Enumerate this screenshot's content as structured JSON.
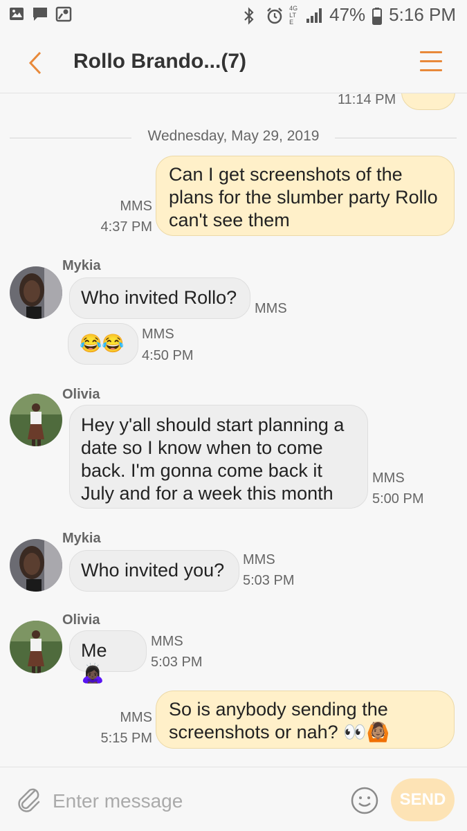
{
  "status_bar": {
    "battery": "47%",
    "time": "5:16 PM",
    "network": "4G LTE"
  },
  "header": {
    "title": "Rollo Brando...(7)"
  },
  "conversation": {
    "prev_time": "11:14 PM",
    "date_separator": "Wednesday, May 29, 2019",
    "messages": [
      {
        "dir": "out",
        "text": "Can I get screenshots of the plans for the slumber party Rollo can't see them",
        "type": "MMS",
        "time": "4:37 PM"
      },
      {
        "dir": "in",
        "sender": "Mykia",
        "text": "Who invited Rollo?",
        "type": "MMS"
      },
      {
        "dir": "in",
        "text": "😂😂",
        "type": "MMS",
        "time": "4:50 PM"
      },
      {
        "dir": "in",
        "sender": "Olivia",
        "text": "Hey y'all should start planning a date so I know when to come back. I'm gonna come back it July and for a week this month",
        "type": "MMS",
        "time": "5:00 PM"
      },
      {
        "dir": "in",
        "sender": "Mykia",
        "text": "Who invited you?",
        "type": "MMS",
        "time": "5:03 PM"
      },
      {
        "dir": "in",
        "sender": "Olivia",
        "text": "Me 🙇🏿‍♀️",
        "type": "MMS",
        "time": "5:03 PM"
      },
      {
        "dir": "out",
        "text": "So is anybody sending the screenshots or nah? 👀🙆🏽",
        "type": "MMS",
        "time": "5:15 PM"
      }
    ]
  },
  "composer": {
    "placeholder": "Enter message",
    "send_label": "SEND"
  },
  "colors": {
    "accent": "#e8893a",
    "outgoing_bubble": "#fff0c9",
    "incoming_bubble": "#eeeeee",
    "send_button": "#fde3b5"
  }
}
